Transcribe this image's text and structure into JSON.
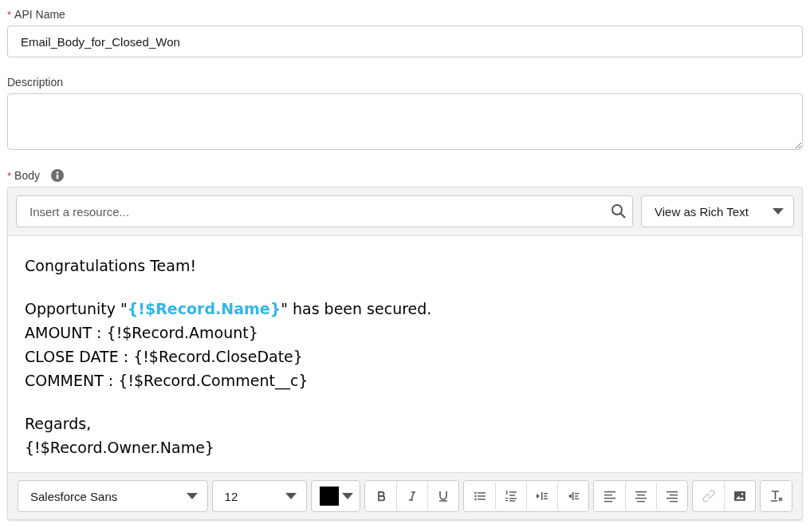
{
  "api_name": {
    "label": "API Name",
    "required_mark": "*",
    "value": "Email_Body_for_Closed_Won"
  },
  "description": {
    "label": "Description"
  },
  "body": {
    "label": "Body",
    "required_mark": "*",
    "resource_search": {
      "placeholder": "Insert a resource..."
    },
    "view_mode": {
      "value": "View as Rich Text"
    },
    "paragraphs": [
      {
        "lines": [
          "Congratulations Team!"
        ]
      },
      {
        "lines": [
          "Opportunity \"**{!$Record.Name}**\" has been secured.",
          "AMOUNT : {!$Record.Amount}",
          "CLOSE DATE : {!$Record.CloseDate}",
          "COMMENT : {!$Record.Comment__c}"
        ]
      },
      {
        "lines": [
          "Regards,",
          "{!$Record.Owner.Name}"
        ]
      }
    ],
    "toolbar": {
      "font": "Salesforce Sans",
      "size": "12",
      "color": "#000000",
      "groups": [
        [
          {
            "kind": "bold",
            "disabled": false
          },
          {
            "kind": "italic",
            "disabled": false
          },
          {
            "kind": "underline",
            "disabled": false
          }
        ],
        [
          {
            "kind": "bullets",
            "disabled": false
          },
          {
            "kind": "numbers",
            "disabled": false
          },
          {
            "kind": "indent",
            "disabled": false
          },
          {
            "kind": "outdent",
            "disabled": false
          }
        ],
        [
          {
            "kind": "align-left",
            "disabled": false
          },
          {
            "kind": "align-center",
            "disabled": false
          },
          {
            "kind": "align-right",
            "disabled": false
          }
        ],
        [
          {
            "kind": "link",
            "disabled": true
          },
          {
            "kind": "image",
            "disabled": false
          }
        ],
        [
          {
            "kind": "clear-format",
            "disabled": false
          }
        ]
      ]
    }
  }
}
